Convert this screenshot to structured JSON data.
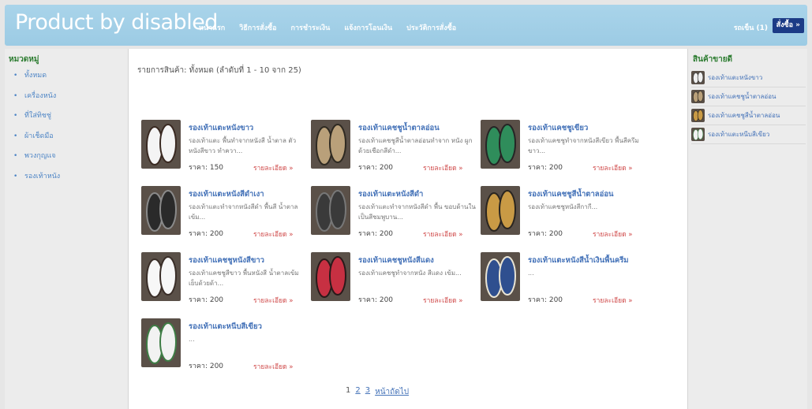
{
  "header": {
    "title": "Product by disabled",
    "nav": [
      "หน้าแรก",
      "วิธีการสั่งซื้อ",
      "การชำระเงิน",
      "แจ้งการโอนเงิน",
      "ประวัติการสั่งซื้อ"
    ],
    "cart_label": "รถเข็น (1)",
    "order_label": "สั่งซื้อ »"
  },
  "sidebar": {
    "heading": "หมวดหมู่",
    "items": [
      "ทั้งหมด",
      "เครื่องหนัง",
      "ที่ใส่ทิชชู่",
      "ผ้าเช็ดมือ",
      "พวงกุญแจ",
      "รองเท้าหนัง"
    ]
  },
  "main": {
    "summary": "รายการสินค้า: ทั้งหมด (ลำดับที่ 1 - 10 จาก 25)",
    "products": [
      {
        "name": "รองเท้าแตะหนังขาว",
        "desc": "รองเท้าแตะ พื้นทำจากหนังสี น้ำตาล ตัวหนังสีขาว ทำควา...",
        "price": "ราคา: 150",
        "more": "รายละเอียด »",
        "color": "#f4f4f4",
        "accent": "#3a2a22"
      },
      {
        "name": "รองเท้าแคชชูน้ำตาลอ่อน",
        "desc": "รองเท้าแคชชูสีน้ำตาลอ่อนทำจาก หนัง ผูกด้วยเชือกสีดำ...",
        "price": "ราคา: 200",
        "more": "รายละเอียด »",
        "color": "#b9a07a",
        "accent": "#2f2a22"
      },
      {
        "name": "รองเท้าแคชชูเขียว",
        "desc": "รองเท้าแคชชูทำจากหนังสีเขียว พื้นสีครีมขาว...",
        "price": "ราคา: 200",
        "more": "รายละเอียด »",
        "color": "#2f8d5b",
        "accent": "#252525"
      },
      {
        "name": "รองเท้าแตะหนังสีดำเงา",
        "desc": "รองเท้าแตะทำจากหนังสีดำ พื้นสี น้ำตาลเข้ม...",
        "price": "ราคา: 200",
        "more": "รายละเอียด »",
        "color": "#2a2a2a",
        "accent": "#8a8a8a"
      },
      {
        "name": "รองเท้าแตะหนังสีดำ",
        "desc": "รองเท้าแตะทำจากหนังสีดำ พื้น ขอบด้านในเป็นสีชมพูบาน...",
        "price": "ราคา: 200",
        "more": "รายละเอียด »",
        "color": "#3a3a3a",
        "accent": "#777"
      },
      {
        "name": "รองเท้าแคชชูสีน้ำตาลอ่อน",
        "desc": "รองเท้าแคชชูหนังสีกากี...",
        "price": "ราคา: 200",
        "more": "รายละเอียด »",
        "color": "#c99a45",
        "accent": "#2a2520"
      },
      {
        "name": "รองเท้าแคชชูหนังสีขาว",
        "desc": "รองเท้าแคชชูสีขาว พื้นหนังสี น้ำตาลเข้ม เย็บด้วยด้า...",
        "price": "ราคา: 200",
        "more": "รายละเอียด »",
        "color": "#f7f7f7",
        "accent": "#3a2e28"
      },
      {
        "name": "รองเท้าแคชชูหนังสีแดง",
        "desc": "รองเท้าแคชชูทำจากหนัง สีแดง เข้ม...",
        "price": "ราคา: 200",
        "more": "รายละเอียด »",
        "color": "#c73042",
        "accent": "#2a1a1a"
      },
      {
        "name": "รองเท้าแตะหนังสีน้ำเงินพื้นครีม",
        "desc": "...",
        "price": "ราคา: 200",
        "more": "รายละเอียด »",
        "color": "#2f4f8f",
        "accent": "#e9e4d4"
      },
      {
        "name": "รองเท้าแตะหนีบสีเขียว",
        "desc": "...",
        "price": "ราคา: 200",
        "more": "รายละเอียด »",
        "color": "#f2f2f2",
        "accent": "#3e7d45"
      }
    ],
    "pagination": {
      "current": "1",
      "pages": [
        "2",
        "3"
      ],
      "next": "หน้าถัดไป"
    }
  },
  "bestsellers": {
    "heading": "สินค้าขายดี",
    "items": [
      {
        "label": "รองเท้าแตะหนังขาว",
        "color": "#efefef",
        "accent": "#333"
      },
      {
        "label": "รองเท้าแคชชูน้ำตาลอ่อน",
        "color": "#b9a07a",
        "accent": "#2f2a22"
      },
      {
        "label": "รองเท้าแคชชูสีน้ำตาลอ่อน",
        "color": "#c99a45",
        "accent": "#2a2520"
      },
      {
        "label": "รองเท้าแตะหนีบสีเขียว",
        "color": "#f2f2f2",
        "accent": "#3e7d45"
      }
    ]
  }
}
